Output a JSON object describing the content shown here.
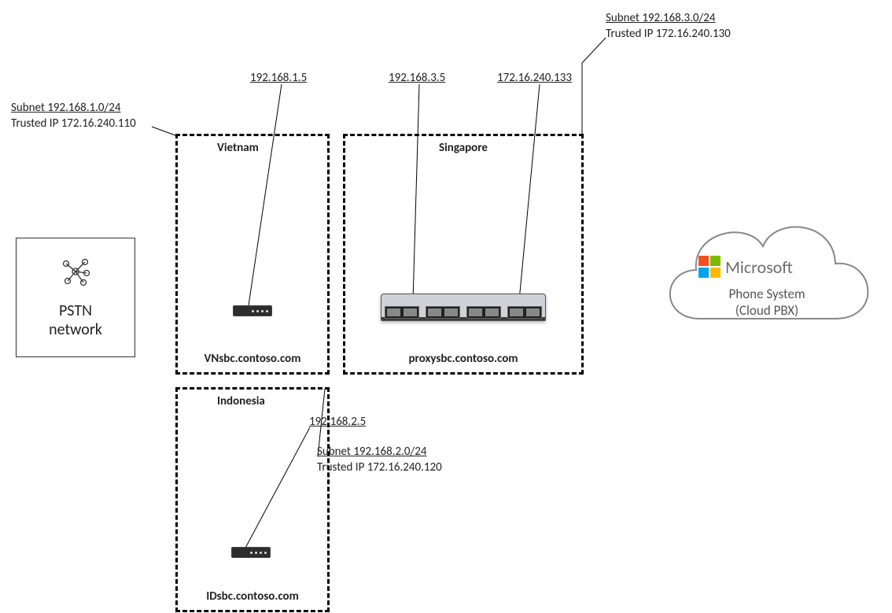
{
  "pstn": {
    "title_l1": "PSTN",
    "title_l2": "network"
  },
  "cloud": {
    "brand": "Microsoft",
    "line1": "Phone System",
    "line2": "(Cloud PBX)"
  },
  "top_callouts": {
    "vietnam_ip": "192.168.1.5",
    "singapore_ip": "192.168.3.5",
    "proxy_public_ip": "172.16.240.133",
    "singapore_subnet": "Subnet 192.168.3.0/24",
    "singapore_trusted": "Trusted IP 172.16.240.130"
  },
  "left_callouts": {
    "vietnam_subnet": "Subnet 192.168.1.0/24",
    "vietnam_trusted": "Trusted IP 172.16.240.110"
  },
  "indonesia_callouts": {
    "ip": "192.168.2.5",
    "subnet": "Subnet 192.168.2.0/24",
    "trusted": "Trusted IP 172.16.240.120"
  },
  "sites": {
    "vietnam": {
      "title": "Vietnam",
      "host": "VNsbc.contoso.com"
    },
    "singapore": {
      "title": "Singapore",
      "host": "proxysbc.contoso.com"
    },
    "indonesia": {
      "title": "Indonesia",
      "host": "IDsbc.contoso.com"
    }
  }
}
